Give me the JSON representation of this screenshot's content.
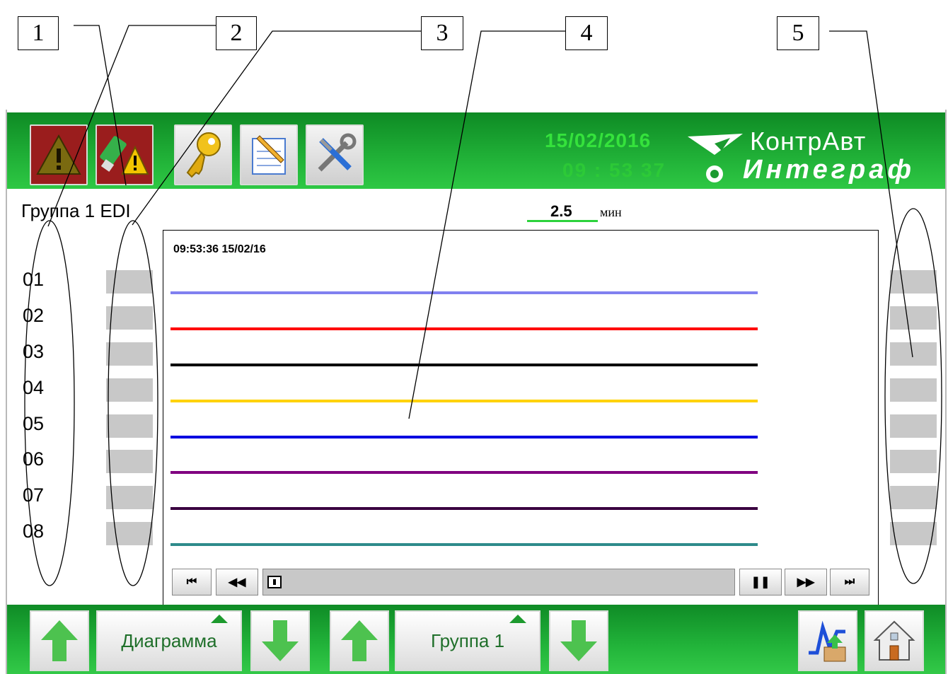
{
  "callouts": [
    "1",
    "2",
    "3",
    "4",
    "5"
  ],
  "header": {
    "date": "15/02/2016",
    "time": "09 : 53   37",
    "brand_line1": "КонтрАвт",
    "brand_line2": "Интеграф"
  },
  "toolbar": {
    "icons": [
      "alarm-warning-icon",
      "usb-warning-icon",
      "key-icon",
      "notepad-icon",
      "tools-icon"
    ]
  },
  "group_title": "Группа 1 EDI",
  "period": {
    "value": "2.5",
    "unit": "мин"
  },
  "channels": [
    "01",
    "02",
    "03",
    "04",
    "05",
    "06",
    "07",
    "08"
  ],
  "chart": {
    "timestamp": "09:53:36  15/02/16",
    "trend_colors": [
      "#8080f0",
      "#ff0000",
      "#000000",
      "#ffd200",
      "#0000e0",
      "#800080",
      "#3a0040",
      "#2e8b8b"
    ]
  },
  "player": {
    "first": "⏮",
    "rewind": "◀◀",
    "pause": "❚❚",
    "forward": "▶▶",
    "last": "⏭"
  },
  "bottom": {
    "view_label": "Диаграмма",
    "group_label": "Группа 1"
  }
}
